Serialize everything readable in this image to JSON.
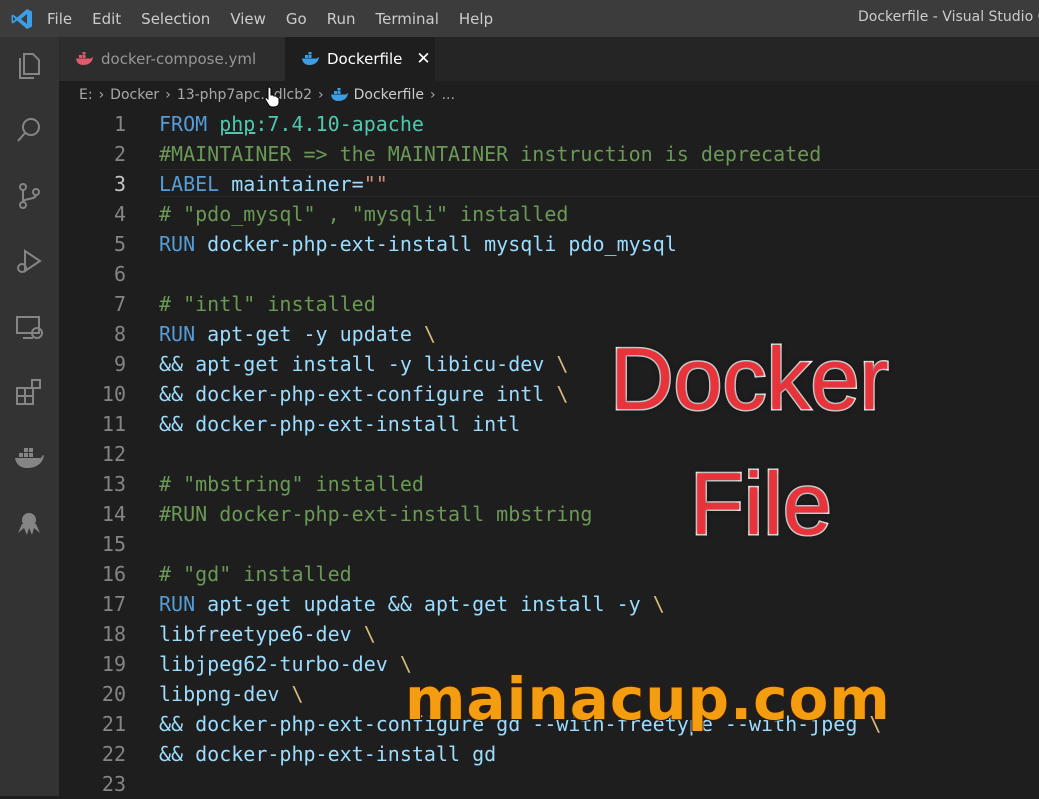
{
  "window": {
    "title": "Dockerfile - Visual Studio Co",
    "menu": [
      "File",
      "Edit",
      "Selection",
      "View",
      "Go",
      "Run",
      "Terminal",
      "Help"
    ]
  },
  "activity_bar": [
    "files-icon",
    "search-icon",
    "source-control-icon",
    "run-debug-icon",
    "remote-explorer-icon",
    "extensions-icon",
    "docker-icon",
    "octopus-icon"
  ],
  "tabs": [
    {
      "label": "docker-compose.yml",
      "icon": "docker-compose-icon",
      "active": false
    },
    {
      "label": "Dockerfile",
      "icon": "docker-icon",
      "active": true,
      "close": "✕"
    }
  ],
  "breadcrumb": {
    "items": [
      "E:",
      "Docker",
      "13-php7apc...dlcb2"
    ],
    "current": "Dockerfile",
    "ellipsis": "..."
  },
  "editor": {
    "active_line": 3,
    "lines": [
      [
        {
          "t": "kw",
          "v": "FROM "
        },
        {
          "t": "img",
          "v": "php"
        },
        {
          "t": "ver",
          "v": ":7.4.10-apache"
        }
      ],
      [
        {
          "t": "cm",
          "v": "#MAINTAINER => the MAINTAINER instruction is deprecated"
        }
      ],
      [
        {
          "t": "kw",
          "v": "LABEL "
        },
        {
          "t": "p",
          "v": "maintainer="
        },
        {
          "t": "str",
          "v": "\"\""
        }
      ],
      [
        {
          "t": "cm",
          "v": "# \"pdo_mysql\" , \"mysqli\" installed"
        }
      ],
      [
        {
          "t": "kw",
          "v": "RUN "
        },
        {
          "t": "p",
          "v": "docker-php-ext-install mysqli pdo_mysql"
        }
      ],
      [],
      [
        {
          "t": "cm",
          "v": "# \"intl\" installed"
        }
      ],
      [
        {
          "t": "kw",
          "v": "RUN "
        },
        {
          "t": "p",
          "v": "apt-get -y update "
        },
        {
          "t": "esc",
          "v": "\\"
        }
      ],
      [
        {
          "t": "p",
          "v": "&& apt-get install -y libicu-dev "
        },
        {
          "t": "esc",
          "v": "\\"
        }
      ],
      [
        {
          "t": "p",
          "v": "&& docker-php-ext-configure intl "
        },
        {
          "t": "esc",
          "v": "\\"
        }
      ],
      [
        {
          "t": "p",
          "v": "&& docker-php-ext-install intl"
        }
      ],
      [],
      [
        {
          "t": "cm",
          "v": "# \"mbstring\" installed"
        }
      ],
      [
        {
          "t": "cm",
          "v": "#RUN docker-php-ext-install mbstring"
        }
      ],
      [],
      [
        {
          "t": "cm",
          "v": "# \"gd\" installed"
        }
      ],
      [
        {
          "t": "kw",
          "v": "RUN "
        },
        {
          "t": "p",
          "v": "apt-get update && apt-get install -y "
        },
        {
          "t": "esc",
          "v": "\\"
        }
      ],
      [
        {
          "t": "p",
          "v": "libfreetype6-dev "
        },
        {
          "t": "esc",
          "v": "\\"
        }
      ],
      [
        {
          "t": "p",
          "v": "libjpeg62-turbo-dev "
        },
        {
          "t": "esc",
          "v": "\\"
        }
      ],
      [
        {
          "t": "p",
          "v": "libpng-dev "
        },
        {
          "t": "esc",
          "v": "\\"
        }
      ],
      [
        {
          "t": "p",
          "v": "&& docker-php-ext-configure gd --with-freetype --with-jpeg "
        },
        {
          "t": "esc",
          "v": "\\"
        }
      ],
      [
        {
          "t": "p",
          "v": "&& docker-php-ext-install gd"
        }
      ],
      []
    ]
  },
  "overlay": {
    "line1": "Docker",
    "line2": "File",
    "site": "mainacup.com"
  }
}
